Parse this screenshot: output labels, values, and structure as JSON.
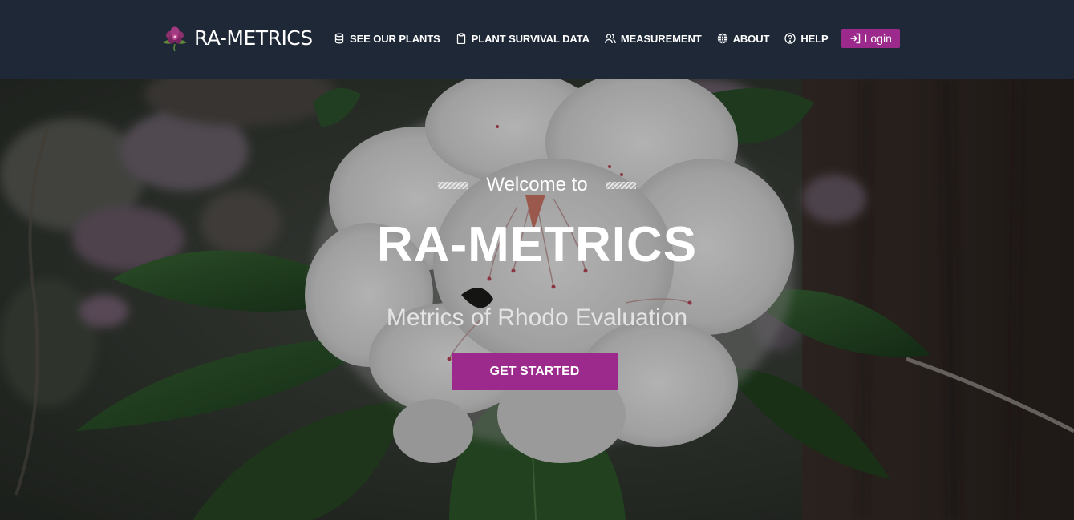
{
  "brand": {
    "name": "RA-METRICS",
    "logo_icon": "rhododendron-flower-icon"
  },
  "nav": {
    "items": [
      {
        "label": "SEE OUR PLANTS",
        "icon": "database-icon"
      },
      {
        "label": "PLANT SURVIVAL DATA",
        "icon": "clipboard-icon"
      },
      {
        "label": "MEASUREMENT",
        "icon": "users-icon"
      },
      {
        "label": "ABOUT",
        "icon": "globe-icon"
      },
      {
        "label": "HELP",
        "icon": "question-circle-icon"
      }
    ],
    "login": {
      "label": "Login",
      "icon": "login-arrow-icon"
    }
  },
  "hero": {
    "welcome": "Welcome to",
    "title": "RA-METRICS",
    "subtitle": "Metrics of Rhodo Evaluation",
    "cta": "GET STARTED",
    "background": "white-rhododendron-photo"
  },
  "colors": {
    "navbar_bg": "#1e2837",
    "accent": "#9c2a8c",
    "text": "#ffffff"
  }
}
